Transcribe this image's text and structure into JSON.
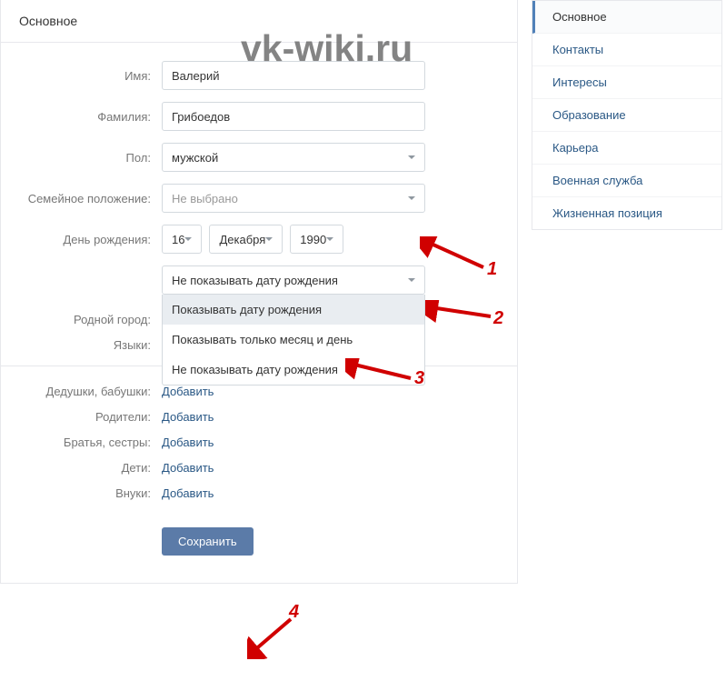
{
  "watermark": "vk-wiki.ru",
  "header": {
    "title": "Основное"
  },
  "form": {
    "first_name": {
      "label": "Имя:",
      "value": "Валерий"
    },
    "last_name": {
      "label": "Фамилия:",
      "value": "Грибоедов"
    },
    "gender": {
      "label": "Пол:",
      "value": "мужской"
    },
    "marital": {
      "label": "Семейное положение:",
      "placeholder": "Не выбрано"
    },
    "dob": {
      "label": "День рождения:",
      "day": "16",
      "month": "Декабря",
      "year": "1990"
    },
    "dob_visibility": {
      "selected": "Не показывать дату рождения",
      "options": [
        "Показывать дату рождения",
        "Показывать только месяц и день",
        "Не показывать дату рождения"
      ]
    },
    "hometown": {
      "label": "Родной город:"
    },
    "languages": {
      "label": "Языки:"
    }
  },
  "family": {
    "grandparents": {
      "label": "Дедушки, бабушки:",
      "add": "Добавить"
    },
    "parents": {
      "label": "Родители:",
      "add": "Добавить"
    },
    "siblings": {
      "label": "Братья, сестры:",
      "add": "Добавить"
    },
    "children": {
      "label": "Дети:",
      "add": "Добавить"
    },
    "grandchildren": {
      "label": "Внуки:",
      "add": "Добавить"
    }
  },
  "buttons": {
    "save": "Сохранить"
  },
  "sidebar": {
    "items": [
      {
        "label": "Основное",
        "active": true
      },
      {
        "label": "Контакты"
      },
      {
        "label": "Интересы"
      },
      {
        "label": "Образование"
      },
      {
        "label": "Карьера"
      },
      {
        "label": "Военная служба"
      },
      {
        "label": "Жизненная позиция"
      }
    ]
  },
  "annotations": {
    "n1": "1",
    "n2": "2",
    "n3": "3",
    "n4": "4"
  }
}
